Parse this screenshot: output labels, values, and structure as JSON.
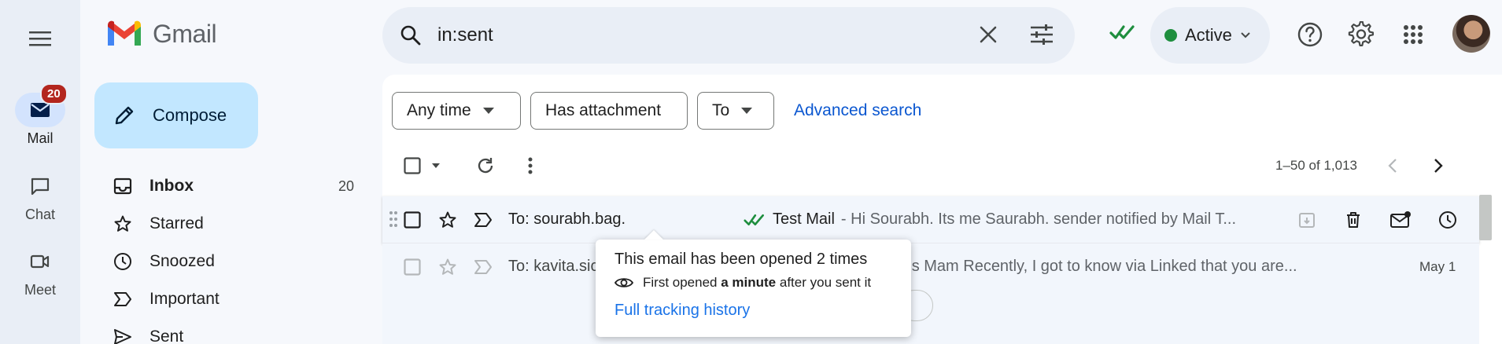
{
  "app": {
    "name": "Gmail"
  },
  "rail": {
    "items": [
      {
        "label": "Mail",
        "badge": "20",
        "icon": "mail-icon"
      },
      {
        "label": "Chat",
        "icon": "chat-icon"
      },
      {
        "label": "Meet",
        "icon": "meet-icon"
      }
    ]
  },
  "compose_label": "Compose",
  "nav": [
    {
      "label": "Inbox",
      "count": "20",
      "icon": "inbox-icon"
    },
    {
      "label": "Starred",
      "icon": "star-icon"
    },
    {
      "label": "Snoozed",
      "icon": "clock-icon"
    },
    {
      "label": "Important",
      "icon": "important-icon"
    },
    {
      "label": "Sent",
      "icon": "send-icon"
    }
  ],
  "search": {
    "value": "in:sent"
  },
  "status": {
    "label": "Active",
    "color": "#1e8e3e"
  },
  "filters": {
    "time": "Any time",
    "attachment": "Has attachment",
    "to": "To",
    "advanced": "Advanced search"
  },
  "pager": {
    "range": "1–50 of 1,013"
  },
  "emails": [
    {
      "recipient": "To: sourabh.bag.",
      "subject": "Test Mail",
      "snippet": "- Hi Sourabh. Its me Saurabh. sender notified by Mail T..."
    },
    {
      "recipient": "To: kavita.sic",
      "snippet": "ings Mam Recently, I got to know via Linked that you are...",
      "date": "May 1"
    }
  ],
  "tooltip": {
    "title": "This email has been opened 2 times",
    "line_prefix": "First opened",
    "line_bold": "a minute",
    "line_suffix": "after you sent it",
    "link": "Full tracking history"
  },
  "colors": {
    "accent_blue": "#0b57d0",
    "tick_green": "#1e8e3e",
    "badge_red": "#b3261e"
  }
}
